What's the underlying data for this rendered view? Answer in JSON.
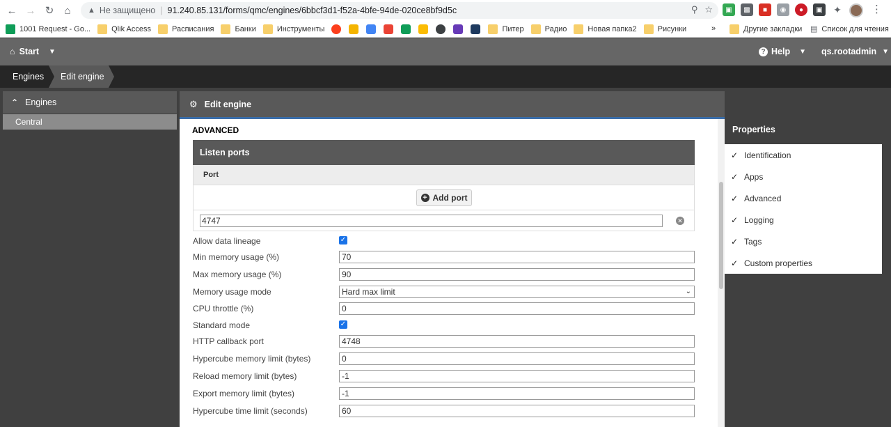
{
  "browser": {
    "security_label": "Не защищено",
    "url": "91.240.85.131/forms/qmc/engines/6bbcf3d1-f52a-4bfe-94de-020ce8bf9d5c",
    "bookmarks": [
      {
        "label": "1001 Request - Go...",
        "icon": "sheets-icon",
        "color": "#0f9d58"
      },
      {
        "label": "Qlik Access",
        "icon": "folder-icon",
        "color": "#f7cf6b"
      },
      {
        "label": "Расписания",
        "icon": "folder-icon",
        "color": "#f7cf6b"
      },
      {
        "label": "Банки",
        "icon": "folder-icon",
        "color": "#f7cf6b"
      },
      {
        "label": "Инструменты",
        "icon": "folder-icon",
        "color": "#f7cf6b"
      }
    ],
    "bookmarks_right": [
      {
        "label": "Питер"
      },
      {
        "label": "Радио"
      },
      {
        "label": "Новая папка2"
      },
      {
        "label": "Рисунки"
      }
    ],
    "overflow": "»",
    "other_bookmarks": "Другие закладки",
    "reading_list": "Список для чтения"
  },
  "topbar": {
    "start_label": "Start",
    "help_label": "Help",
    "user_label": "qs.rootadmin"
  },
  "breadcrumb": {
    "items": [
      "Engines",
      "Edit engine"
    ]
  },
  "left_panel": {
    "header": "Engines",
    "items": [
      "Central"
    ]
  },
  "main": {
    "title": "Edit engine",
    "section": "ADVANCED",
    "listen_ports": {
      "title": "Listen ports",
      "column": "Port",
      "add_button": "Add port",
      "port_value": "4747"
    },
    "fields": [
      {
        "label": "Allow data lineage",
        "type": "checkbox",
        "checked": true
      },
      {
        "label": "Min memory usage (%)",
        "type": "text",
        "value": "70"
      },
      {
        "label": "Max memory usage (%)",
        "type": "text",
        "value": "90"
      },
      {
        "label": "Memory usage mode",
        "type": "select",
        "value": "Hard max limit"
      },
      {
        "label": "CPU throttle (%)",
        "type": "text",
        "value": "0"
      },
      {
        "label": "Standard mode",
        "type": "checkbox",
        "checked": true
      },
      {
        "label": "HTTP callback port",
        "type": "text",
        "value": "4748"
      },
      {
        "label": "Hypercube memory limit (bytes)",
        "type": "text",
        "value": "0"
      },
      {
        "label": "Reload memory limit (bytes)",
        "type": "text",
        "value": "-1"
      },
      {
        "label": "Export memory limit (bytes)",
        "type": "text",
        "value": "-1"
      },
      {
        "label": "Hypercube time limit (seconds)",
        "type": "text",
        "value": "60"
      }
    ]
  },
  "properties": {
    "title": "Properties",
    "items": [
      "Identification",
      "Apps",
      "Advanced",
      "Logging",
      "Tags",
      "Custom properties"
    ]
  },
  "colors": {
    "accent_blue": "#3a6da8",
    "checkbox_blue": "#1a73e8",
    "panel_dark": "#595959"
  }
}
